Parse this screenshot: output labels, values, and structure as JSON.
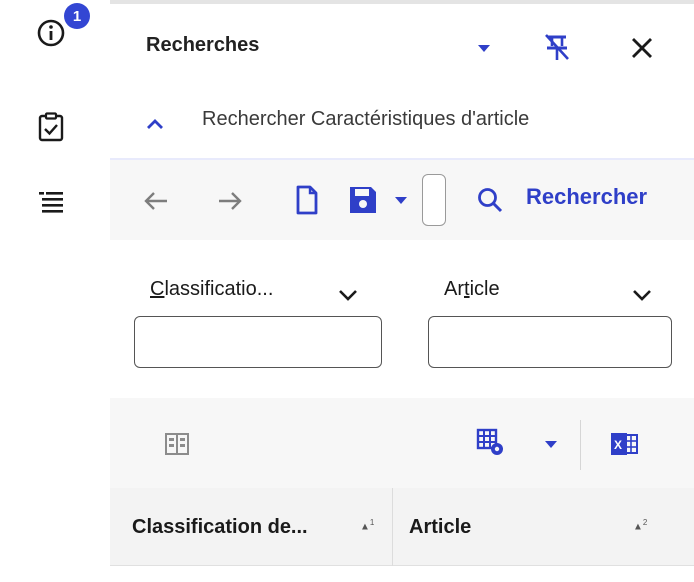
{
  "rail": {
    "info_badge_count": "1",
    "icons": [
      "info-icon",
      "clipboard-check-icon",
      "list-view-icon"
    ]
  },
  "panel": {
    "title": "Recherches",
    "header_icons": [
      "dropdown-caret-icon",
      "unpin-icon",
      "close-icon"
    ]
  },
  "section": {
    "label": "Rechercher Caractéristiques d'article",
    "collapse_icon": "chevron-up-icon"
  },
  "toolbar": {
    "icons": [
      "arrow-left-icon",
      "arrow-right-icon",
      "new-document-icon",
      "save-icon",
      "save-dropdown-caret-icon",
      "search-icon"
    ],
    "search_label": "Rechercher"
  },
  "filters": [
    {
      "label": "Classificatio...",
      "value": "",
      "access_key": "C"
    },
    {
      "label": "Article",
      "value": "",
      "access_key": "t"
    }
  ],
  "grid_toolbar": {
    "icons": [
      "column-chooser-icon",
      "grid-settings-icon",
      "grid-settings-caret-icon",
      "excel-export-icon"
    ]
  },
  "grid": {
    "columns": [
      {
        "label": "Classification de...",
        "sort_order": "1"
      },
      {
        "label": "Article",
        "sort_order": "2"
      }
    ]
  },
  "colors": {
    "accent": "#2f3fc8",
    "badge": "#3346d3",
    "toolbar_bg": "#f7f7f7",
    "header_bg": "#f3f3f3"
  }
}
